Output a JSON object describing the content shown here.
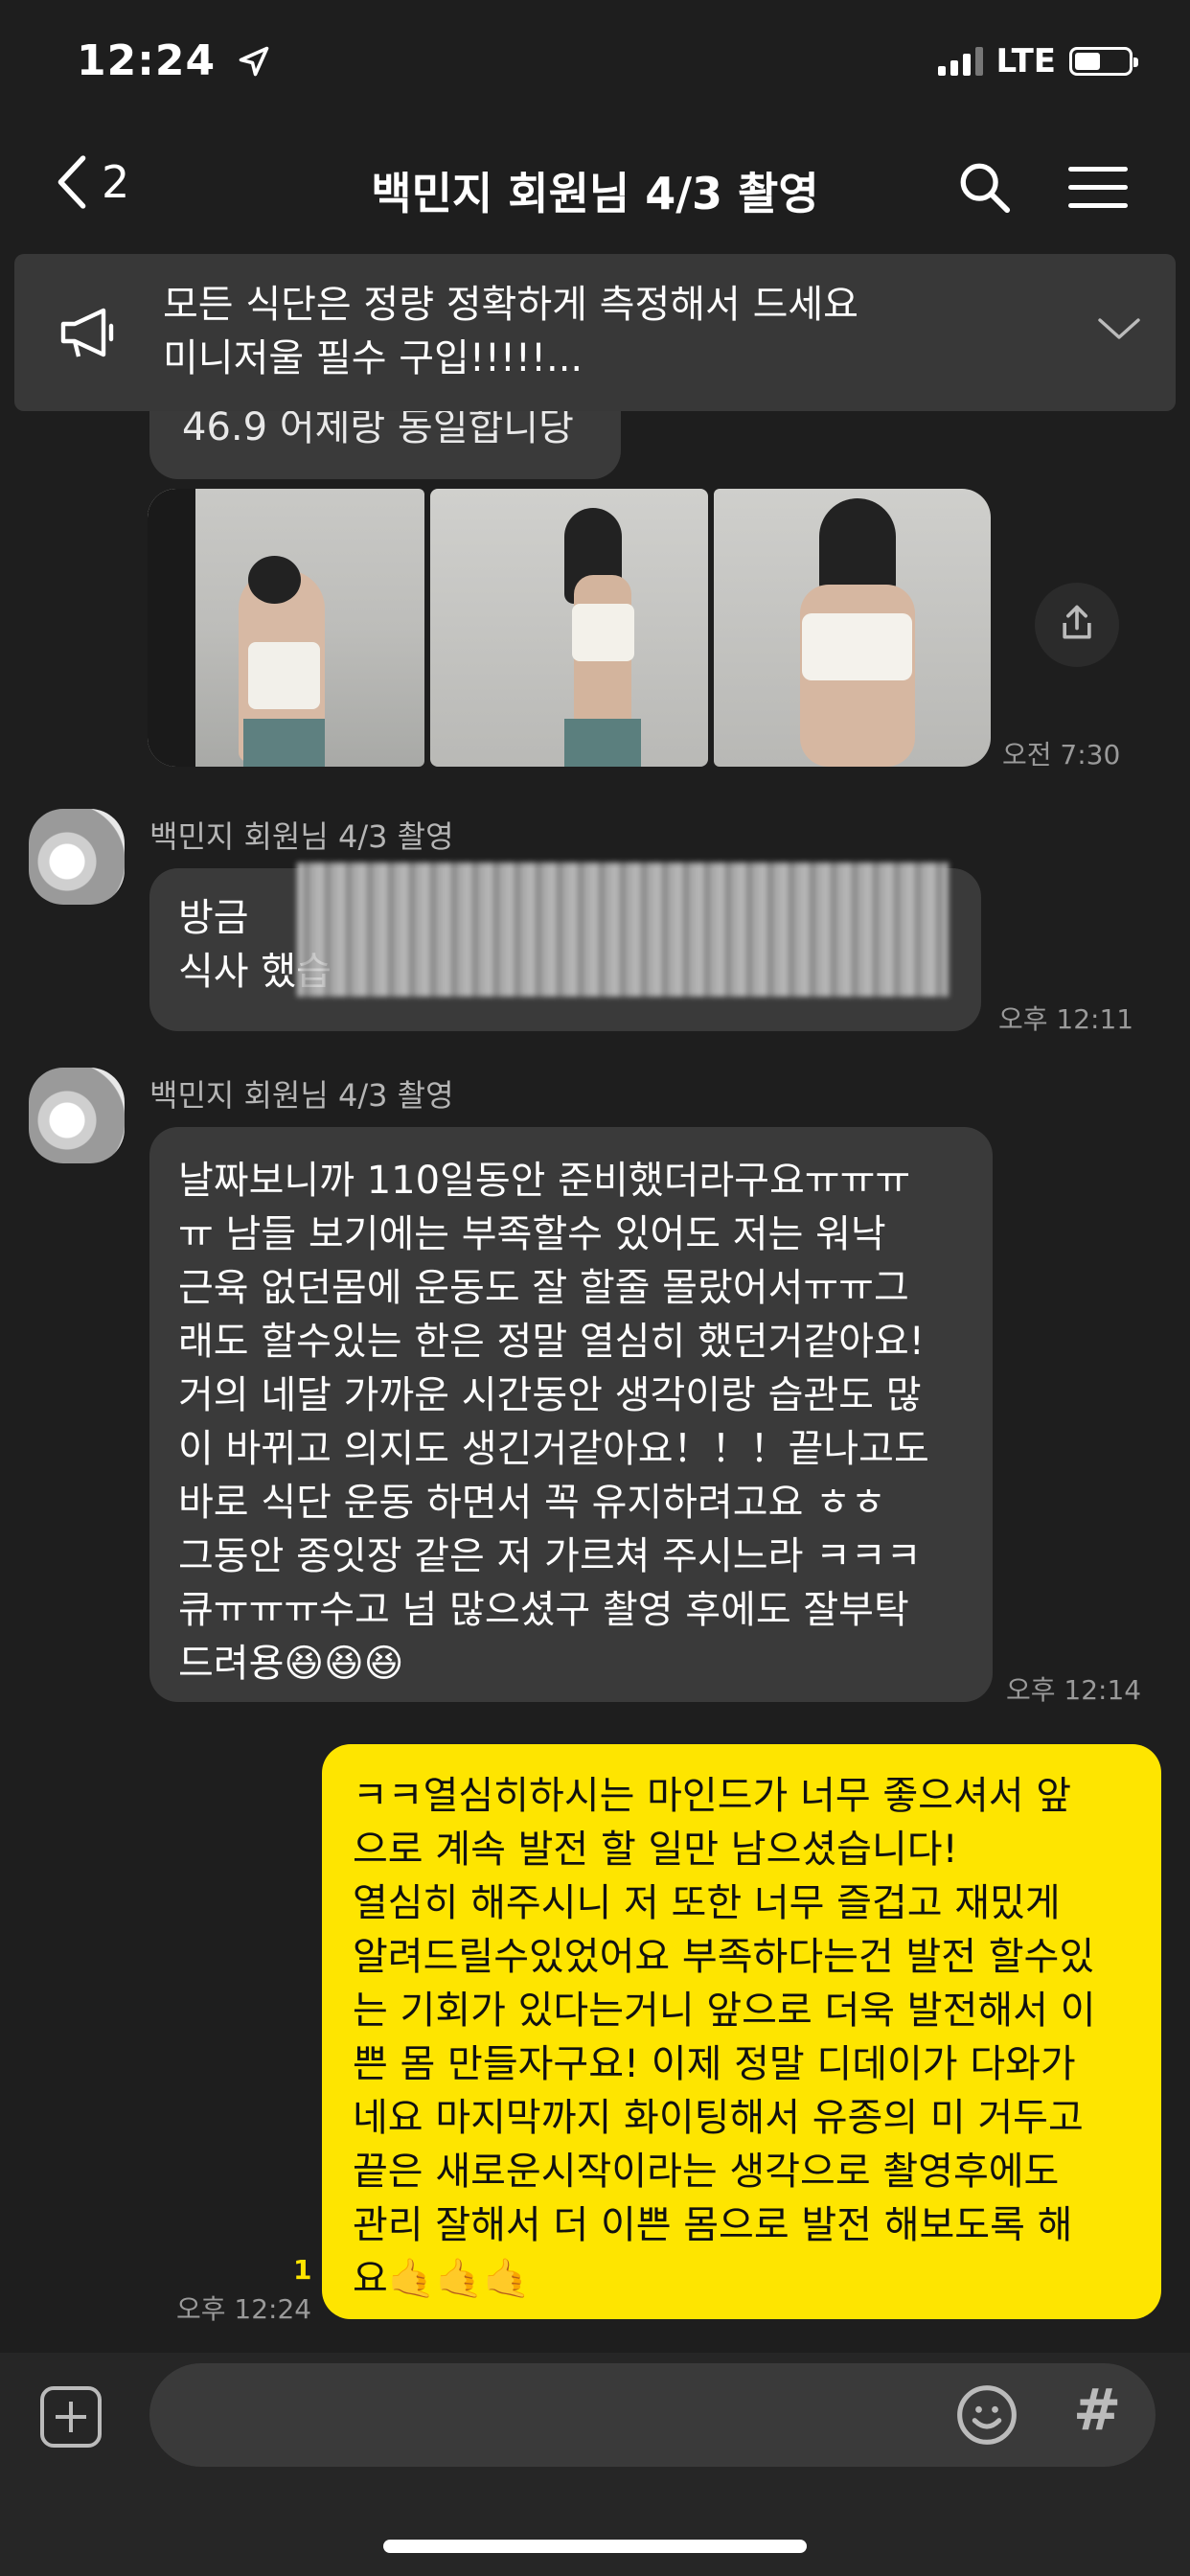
{
  "status_bar": {
    "time": "12:24",
    "network": "LTE",
    "battery_level": 0.5
  },
  "header": {
    "back_count": "2",
    "title": "백민지 회원님 4/3 촬영"
  },
  "notice": {
    "line1": "모든 식단은 정량 정확하게 측정해서 드세요",
    "line2": "미니저울 필수 구입!!!!!..."
  },
  "messages": [
    {
      "type": "incoming_partial",
      "text": "46.9 어제랑 동일합니당"
    },
    {
      "type": "incoming_photos",
      "photos": [
        "back pose photo",
        "front mirror selfie",
        "front mirror selfie close"
      ],
      "time": "오전 7:30"
    },
    {
      "type": "incoming",
      "sender": "백민지 회원님 4/3 촬영",
      "lines": [
        "방금",
        "식사 했습"
      ],
      "time": "오후 12:11"
    },
    {
      "type": "incoming",
      "sender": "백민지 회원님 4/3 촬영",
      "lines": [
        "날짜보니까 110일동안 준비했더라구요ㅠㅠㅠ",
        "ㅠ 남들 보기에는 부족할수 있어도 저는 워낙",
        "근육 없던몸에 운동도 잘 할줄 몰랐어서ㅠㅠ그",
        "래도 할수있는 한은 정말 열심히 했던거같아요!",
        "거의 네달 가까운 시간동안 생각이랑 습관도 많",
        "이 바뀌고 의지도 생긴거같아요！！！끝나고도",
        "바로 식단 운동 하면서 꼭 유지하려고요 ㅎㅎ",
        "그동안 종잇장 같은 저 가르쳐 주시느라 ㅋㅋㅋ",
        "큐ㅠㅠㅠ수고 넘 많으셨구 촬영 후에도 잘부탁",
        "드려용😆😆😆"
      ],
      "time": "오후 12:14"
    },
    {
      "type": "outgoing",
      "lines": [
        "ㅋㅋ열심히하시는 마인드가 너무 좋으셔서 앞",
        "으로 계속 발전 할 일만 남으셨습니다!",
        "열심히 해주시니 저 또한 너무 즐겁고 재밌게",
        "알려드릴수있었어요 부족하다는건 발전 할수있",
        "는 기회가 있다는거니 앞으로 더욱 발전해서 이",
        "쁜 몸 만들자구요! 이제 정말 디데이가 다와가",
        "네요 마지막까지 화이팅해서 유종의 미 거두고",
        "끝은 새로운시작이라는 생각으로 촬영후에도",
        "관리 잘해서 더 이쁜 몸으로 발전 해보도록 해",
        "요🤙🤙🤙"
      ],
      "unread": "1",
      "time": "오후 12:24"
    }
  ],
  "input_bar": {
    "hash": "#"
  },
  "colors": {
    "background": "#1e1e1e",
    "incoming_bubble": "#3a3a3a",
    "outgoing_bubble": "#fee500"
  }
}
